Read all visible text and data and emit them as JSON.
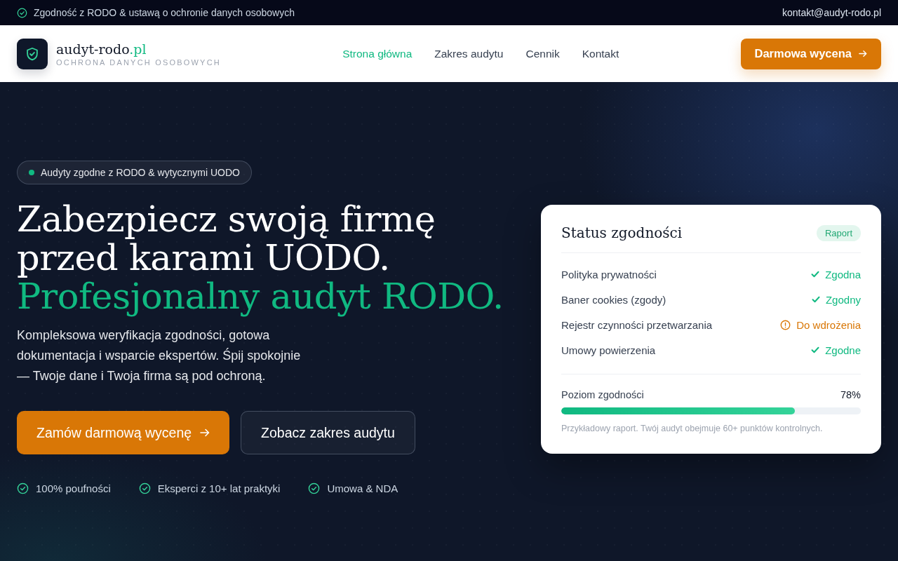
{
  "top_bar": {
    "notice": "Zgodność z RODO & ustawą o ochronie danych osobowych",
    "email": "kontakt@audyt-rodo.pl"
  },
  "header": {
    "brand": {
      "name": "audyt-rodo",
      "suffix": ".pl",
      "tagline": "OCHRONA DANYCH OSOBOWYCH"
    },
    "nav": [
      {
        "label": "Strona główna",
        "selected": true
      },
      {
        "label": "Zakres audytu",
        "selected": false
      },
      {
        "label": "Cennik",
        "selected": false
      },
      {
        "label": "Kontakt",
        "selected": false
      }
    ],
    "cta": "Darmowa wycena"
  },
  "hero": {
    "badge": "Audyty zgodne z RODO & wytycznymi UODO",
    "heading_lines": [
      "Zabezpiecz swoją firmę",
      "przed karami UODO."
    ],
    "heading_accent": "Profesjonalny audyt RODO.",
    "lead": "Kompleksowa weryfikacja zgodności, gotowa dokumentacja i wsparcie ekspertów. Śpij spokojnie — Twoje dane i Twoja firma są pod ochroną.",
    "buttons": [
      {
        "label": "Zamów darmową wycenę",
        "kind": "primary"
      },
      {
        "label": "Zobacz zakres audytu",
        "kind": "secondary"
      }
    ],
    "trust": [
      "100% poufności",
      "Eksperci z 10+ lat praktyki",
      "Umowa & NDA"
    ]
  },
  "status_card": {
    "title": "Status zgodności",
    "tag": "Raport",
    "items": [
      {
        "label": "Polityka prywatności",
        "status": "Zgodna",
        "kind": "ok"
      },
      {
        "label": "Baner cookies (zgody)",
        "status": "Zgodny",
        "kind": "ok"
      },
      {
        "label": "Rejestr czynności przetwarzania",
        "status": "Do wdrożenia",
        "kind": "warning"
      },
      {
        "label": "Umowy powierzenia",
        "status": "Zgodne",
        "kind": "ok"
      }
    ],
    "compliance": {
      "label": "Poziom zgodności",
      "reading": "78%",
      "level": 0.78
    },
    "note": "Przykładowy raport. Twój audyt obejmuje 60+ punktów kontrolnych."
  }
}
